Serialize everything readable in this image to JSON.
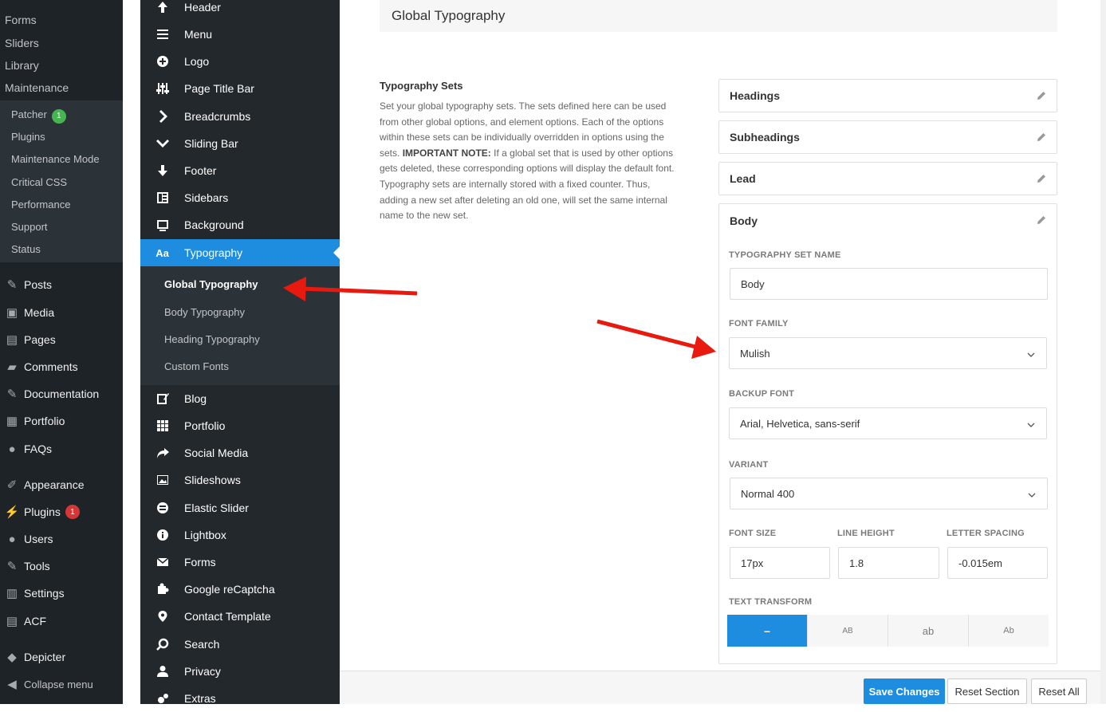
{
  "wp_menu": {
    "top_links": [
      "Forms",
      "Sliders",
      "Library",
      "Maintenance"
    ],
    "patcher_sub": [
      {
        "label": "Patcher",
        "badge": "1"
      },
      {
        "label": "Plugins"
      },
      {
        "label": "Maintenance Mode"
      },
      {
        "label": "Critical CSS"
      },
      {
        "label": "Performance"
      },
      {
        "label": "Support"
      },
      {
        "label": "Status"
      }
    ],
    "main": [
      {
        "label": "Posts",
        "icon": "pin-icon"
      },
      {
        "label": "Media",
        "icon": "media-icon"
      },
      {
        "label": "Pages",
        "icon": "pages-icon"
      },
      {
        "label": "Comments",
        "icon": "comments-icon"
      },
      {
        "label": "Documentation",
        "icon": "pin-icon"
      },
      {
        "label": "Portfolio",
        "icon": "portfolio-icon"
      },
      {
        "label": "FAQs",
        "icon": "info-icon"
      },
      {
        "label": "Appearance",
        "icon": "brush-icon"
      },
      {
        "label": "Plugins",
        "icon": "plugin-icon",
        "badge": "1"
      },
      {
        "label": "Users",
        "icon": "user-icon"
      },
      {
        "label": "Tools",
        "icon": "wrench-icon"
      },
      {
        "label": "Settings",
        "icon": "settings-icon"
      },
      {
        "label": "ACF",
        "icon": "acf-icon"
      },
      {
        "label": "Depicter",
        "icon": "depicter-icon"
      },
      {
        "label": "Collapse menu",
        "icon": "collapse-icon"
      }
    ]
  },
  "avada_menu": {
    "items_top": [
      {
        "label": "Header",
        "icon": "arrow-up-icon"
      },
      {
        "label": "Menu",
        "icon": "menu-icon"
      },
      {
        "label": "Logo",
        "icon": "plus-circle-icon"
      },
      {
        "label": "Page Title Bar",
        "icon": "sliders-icon"
      },
      {
        "label": "Breadcrumbs",
        "icon": "chevron-right-icon"
      },
      {
        "label": "Sliding Bar",
        "icon": "chevron-down-icon"
      },
      {
        "label": "Footer",
        "icon": "arrow-down-icon"
      },
      {
        "label": "Sidebars",
        "icon": "sidebar-icon"
      },
      {
        "label": "Background",
        "icon": "background-icon"
      }
    ],
    "active": {
      "label": "Typography",
      "icon_text": "Aa"
    },
    "sub": [
      {
        "label": "Global Typography",
        "current": true
      },
      {
        "label": "Body Typography"
      },
      {
        "label": "Heading Typography"
      },
      {
        "label": "Custom Fonts"
      }
    ],
    "items_bottom": [
      {
        "label": "Blog",
        "icon": "edit-icon"
      },
      {
        "label": "Portfolio",
        "icon": "grid-icon"
      },
      {
        "label": "Social Media",
        "icon": "share-icon"
      },
      {
        "label": "Slideshows",
        "icon": "image-icon"
      },
      {
        "label": "Elastic Slider",
        "icon": "elastic-icon"
      },
      {
        "label": "Lightbox",
        "icon": "info-icon"
      },
      {
        "label": "Forms",
        "icon": "mail-icon"
      },
      {
        "label": "Google reCaptcha",
        "icon": "puzzle-icon"
      },
      {
        "label": "Contact Template",
        "icon": "location-icon"
      },
      {
        "label": "Search",
        "icon": "search-icon"
      },
      {
        "label": "Privacy",
        "icon": "user-icon"
      },
      {
        "label": "Extras",
        "icon": "gears-icon"
      }
    ]
  },
  "section": {
    "title": "Global Typography",
    "desc_title": "Typography Sets",
    "desc_before": "Set your global typography sets. The sets defined here can be used from other global options, and element options. Each of the options within these sets can be individually overridden in options using the sets. ",
    "desc_strong": "IMPORTANT NOTE:",
    "desc_after": " If a global set that is used by other options gets deleted, these corresponding options will display the default font. Typography sets are internally stored with a fixed counter. Thus, adding a new set after deleting an old one, will set the same internal name to the new set."
  },
  "sets": [
    "Headings",
    "Subheadings",
    "Lead"
  ],
  "body_set": {
    "title": "Body",
    "name_label": "TYPOGRAPHY SET NAME",
    "name_value": "Body",
    "family_label": "FONT FAMILY",
    "family_value": "Mulish",
    "backup_label": "BACKUP FONT",
    "backup_value": "Arial, Helvetica, sans-serif",
    "variant_label": "VARIANT",
    "variant_value": "Normal 400",
    "size_label": "FONT SIZE",
    "size_value": "17px",
    "lh_label": "LINE HEIGHT",
    "lh_value": "1.8",
    "ls_label": "LETTER SPACING",
    "ls_value": "-0.015em",
    "tt_label": "TEXT TRANSFORM",
    "tt_options": [
      "–",
      "AB",
      "ab",
      "Ab"
    ]
  },
  "footer": {
    "save": "Save Changes",
    "reset_section": "Reset Section",
    "reset_all": "Reset All"
  },
  "colors": {
    "accent": "#1e8cdf",
    "arrow": "#e8190f"
  }
}
